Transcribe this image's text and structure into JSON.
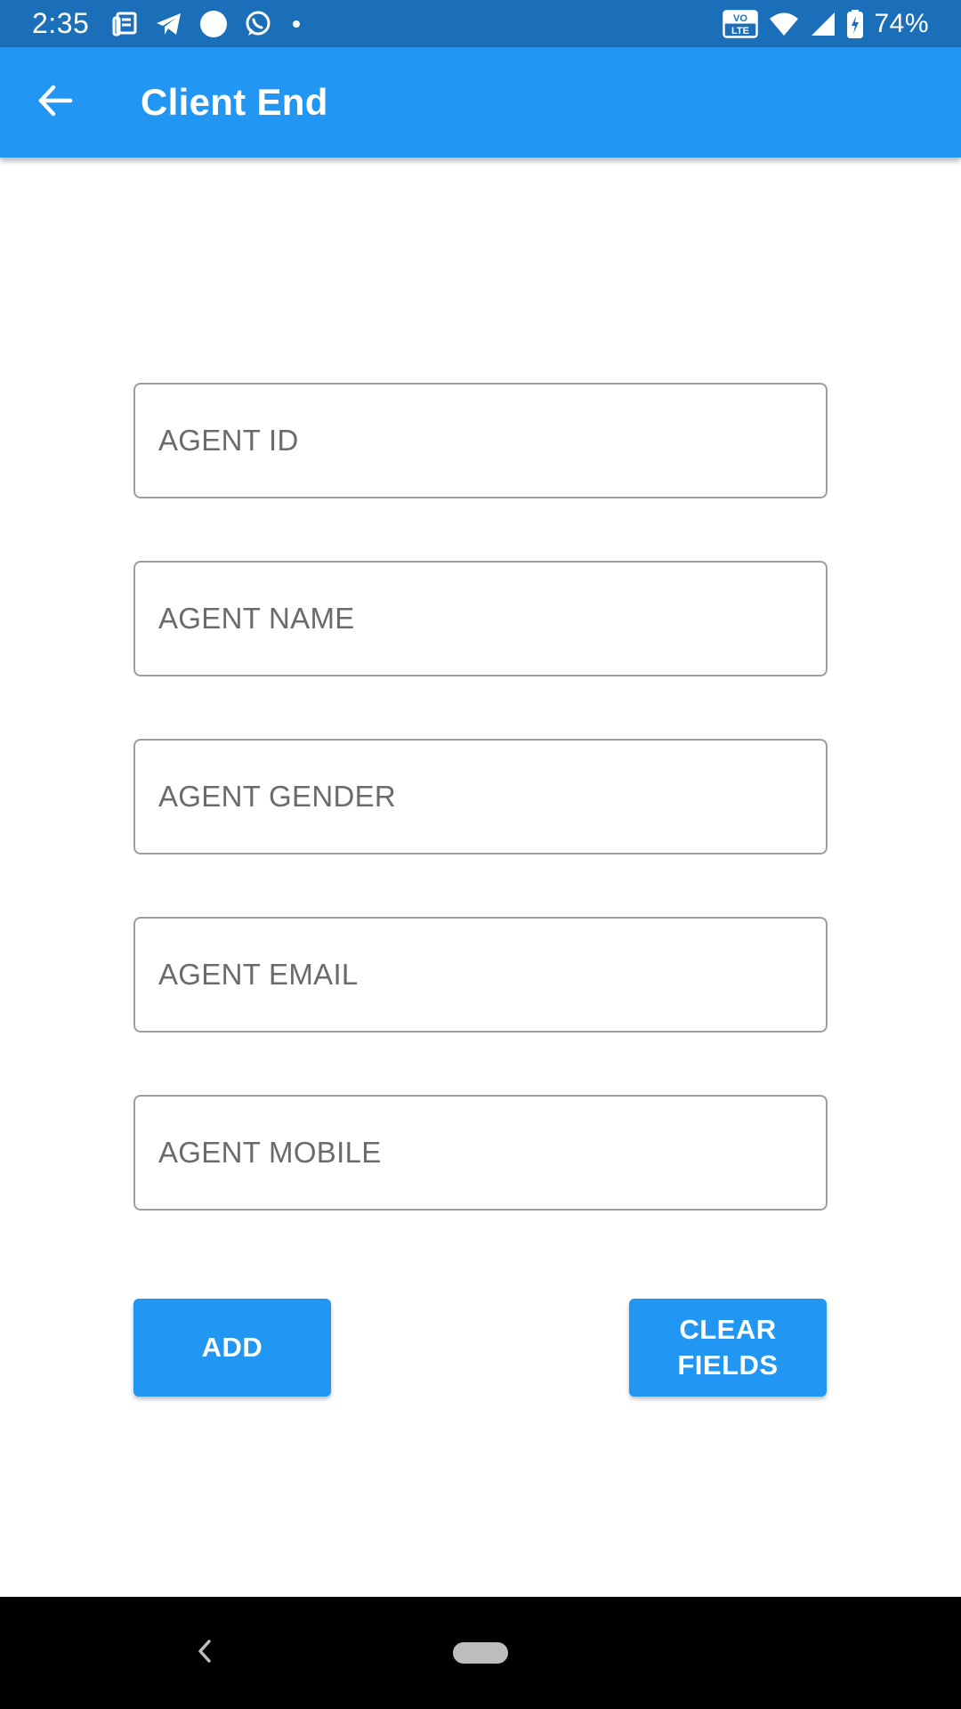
{
  "status_bar": {
    "time": "2:35",
    "battery": "74%",
    "left_icons": [
      "news-icon",
      "telegram-icon",
      "circle-icon",
      "whatsapp-icon",
      "dot-icon"
    ],
    "right_icons": [
      "volte-icon",
      "wifi-icon",
      "signal-icon",
      "battery-charging-icon"
    ],
    "volte_label_top": "VO",
    "volte_label_bottom": "LTE"
  },
  "app_bar": {
    "title": "Client End",
    "back_icon": "arrow-back-icon"
  },
  "form": {
    "fields": [
      {
        "placeholder": "AGENT ID",
        "value": ""
      },
      {
        "placeholder": "AGENT NAME",
        "value": ""
      },
      {
        "placeholder": "AGENT GENDER",
        "value": ""
      },
      {
        "placeholder": "AGENT EMAIL",
        "value": ""
      },
      {
        "placeholder": "AGENT MOBILE",
        "value": ""
      }
    ],
    "add_label": "ADD",
    "clear_label_line1": "CLEAR",
    "clear_label_line2": "FIELDS"
  },
  "nav_bar": {
    "back_icon": "chevron-left-icon",
    "home_icon": "home-pill-icon"
  },
  "colors": {
    "status_bar": "#1b6fb8",
    "primary": "#2196f3",
    "nav_bar": "#000000"
  }
}
